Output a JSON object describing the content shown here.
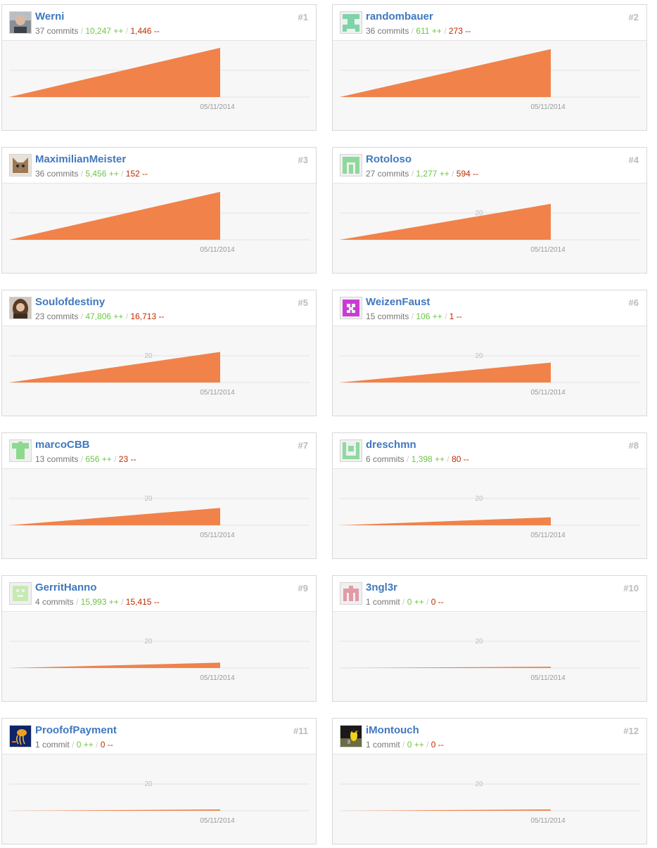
{
  "date_label": "05/11/2014",
  "tick_20": "20",
  "contributors": [
    {
      "name": "Werni",
      "rank": "#1",
      "commits": "37 commits",
      "additions": "10,247 ++",
      "deletions": "1,446 --",
      "avatar": "photo-man-avatar-icon",
      "commit_count": 37
    },
    {
      "name": "randombauer",
      "rank": "#2",
      "commits": "36 commits",
      "additions": "611 ++",
      "deletions": "273 --",
      "avatar": "identicon-green-avatar-icon",
      "commit_count": 36
    },
    {
      "name": "MaximilianMeister",
      "rank": "#3",
      "commits": "36 commits",
      "additions": "5,456 ++",
      "deletions": "152 --",
      "avatar": "cat-avatar-icon",
      "commit_count": 36
    },
    {
      "name": "Rotoloso",
      "rank": "#4",
      "commits": "27 commits",
      "additions": "1,277 ++",
      "deletions": "594 --",
      "avatar": "identicon-green-avatar-icon",
      "commit_count": 27
    },
    {
      "name": "Soulofdestiny",
      "rank": "#5",
      "commits": "23 commits",
      "additions": "47,806 ++",
      "deletions": "16,713 --",
      "avatar": "photo-woman-avatar-icon",
      "commit_count": 23
    },
    {
      "name": "WeizenFaust",
      "rank": "#6",
      "commits": "15 commits",
      "additions": "106 ++",
      "deletions": "1 --",
      "avatar": "identicon-magenta-avatar-icon",
      "commit_count": 15
    },
    {
      "name": "marcoCBB",
      "rank": "#7",
      "commits": "13 commits",
      "additions": "656 ++",
      "deletions": "23 --",
      "avatar": "identicon-green-avatar-icon",
      "commit_count": 13
    },
    {
      "name": "dreschmn",
      "rank": "#8",
      "commits": "6 commits",
      "additions": "1,398 ++",
      "deletions": "80 --",
      "avatar": "identicon-green-avatar-icon",
      "commit_count": 6
    },
    {
      "name": "GerritHanno",
      "rank": "#9",
      "commits": "4 commits",
      "additions": "15,993 ++",
      "deletions": "15,415 --",
      "avatar": "identicon-lightgreen-avatar-icon",
      "commit_count": 4
    },
    {
      "name": "3ngl3r",
      "rank": "#10",
      "commits": "1 commit",
      "additions": "0 ++",
      "deletions": "0 --",
      "avatar": "identicon-pink-avatar-icon",
      "commit_count": 1
    },
    {
      "name": "ProofofPayment",
      "rank": "#11",
      "commits": "1 commit",
      "additions": "0 ++",
      "deletions": "0 --",
      "avatar": "jellyfish-avatar-icon",
      "commit_count": 1
    },
    {
      "name": "iMontouch",
      "rank": "#12",
      "commits": "1 commit",
      "additions": "0 ++",
      "deletions": "0 --",
      "avatar": "penguin-avatar-icon",
      "commit_count": 1
    }
  ],
  "colors": {
    "area": "#f1824a",
    "link": "#4078c0",
    "additions": "#6cc644",
    "deletions": "#bd2c00"
  }
}
